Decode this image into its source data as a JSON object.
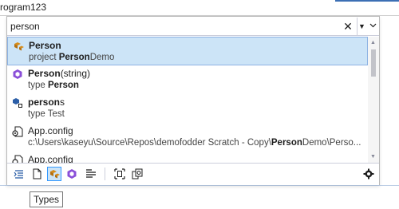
{
  "topbar": {
    "tab_text": "rogram123"
  },
  "search": {
    "value": "person"
  },
  "results": [
    {
      "title_bold": "Person",
      "title_rest": "",
      "sub_prefix": "project ",
      "sub_bold": "Person",
      "sub_rest": "Demo",
      "icon": "class-icon",
      "selected": true
    },
    {
      "title_bold": "Person",
      "title_rest": "(string)",
      "sub_prefix": "type ",
      "sub_bold": "Person",
      "sub_rest": "",
      "icon": "method-icon",
      "selected": false
    },
    {
      "title_bold": "person",
      "title_rest": "s",
      "sub_prefix": "type Test",
      "sub_bold": "",
      "sub_rest": "",
      "icon": "field-icon",
      "selected": false
    },
    {
      "title_bold": "",
      "title_rest": "App.config",
      "sub_prefix": "c:\\Users\\kaseyu\\Source\\Repos\\demofodder Scratch - Copy\\",
      "sub_bold": "Person",
      "sub_rest": "Demo\\Perso...",
      "icon": "file-icon",
      "selected": false
    },
    {
      "title_bold": "",
      "title_rest": "App.config",
      "sub_prefix": "",
      "sub_bold": "",
      "sub_rest": "",
      "icon": "file-icon",
      "selected": false
    }
  ],
  "tooltip": {
    "text": "Types"
  },
  "colors": {
    "accent": "#3c6fb4",
    "selected_bg": "#cce4f7",
    "purple_icon": "#8a4fd8",
    "orange_icon": "#d78c1a"
  }
}
